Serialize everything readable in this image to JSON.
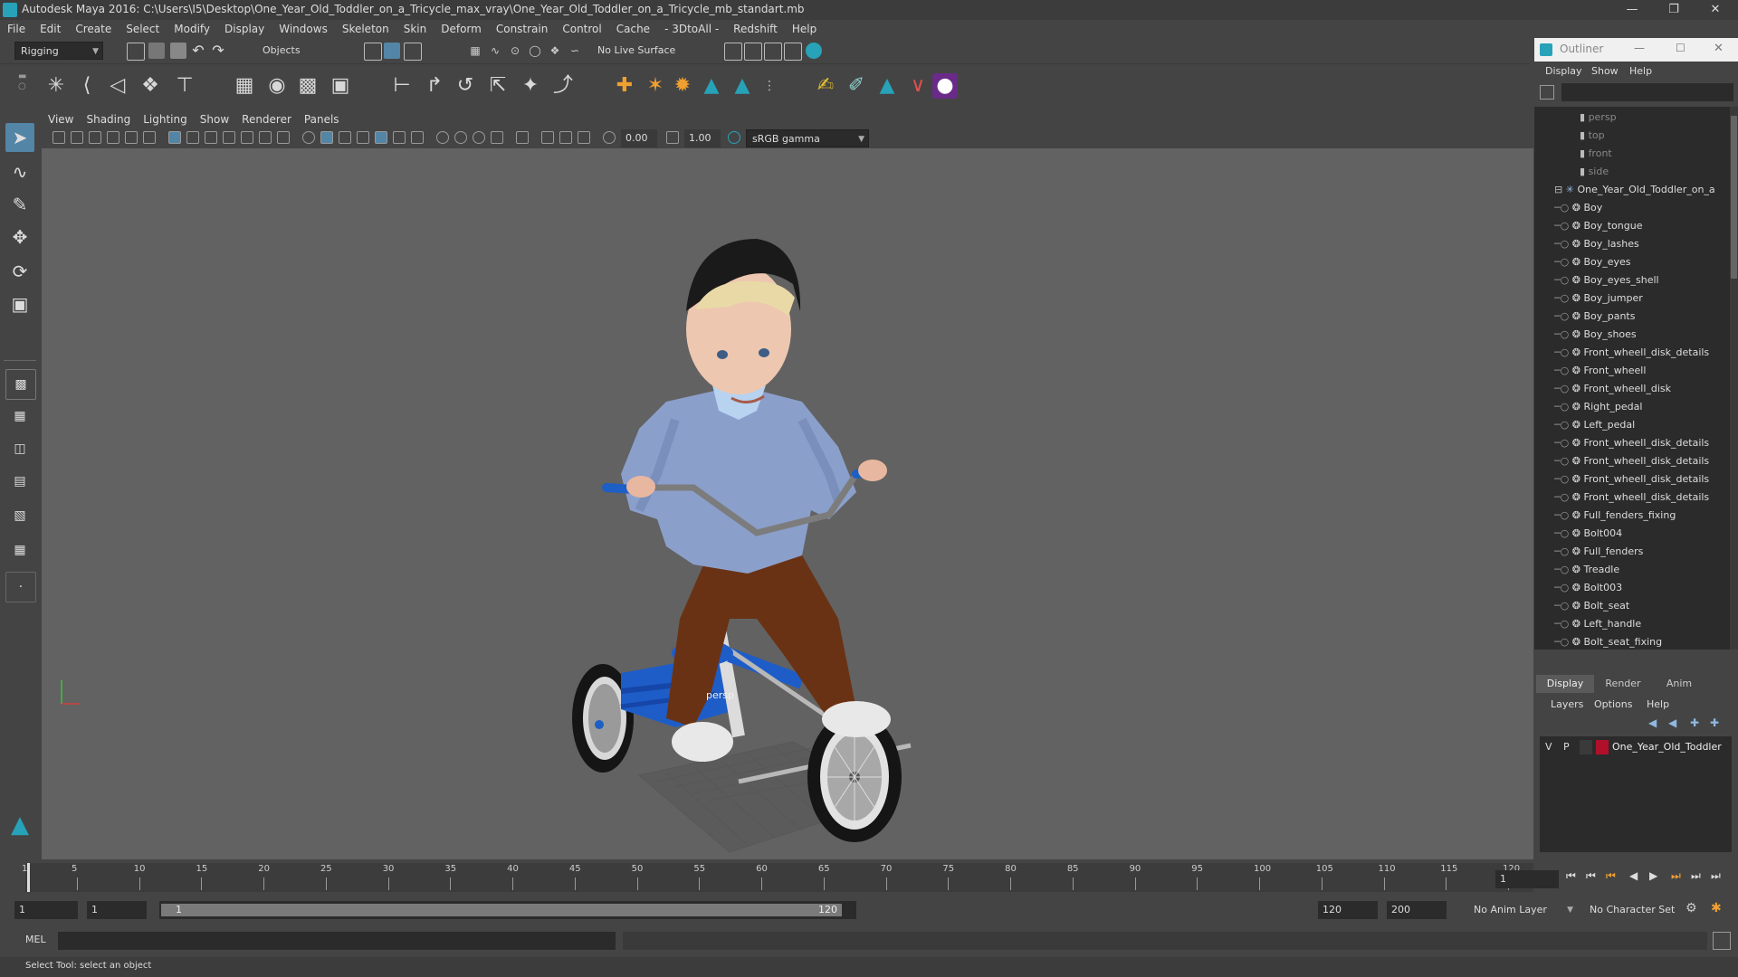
{
  "window": {
    "title": "Autodesk Maya 2016: C:\\Users\\I5\\Desktop\\One_Year_Old_Toddler_on_a_Tricycle_max_vray\\One_Year_Old_Toddler_on_a_Tricycle_mb_standart.mb"
  },
  "menubar": [
    "File",
    "Edit",
    "Create",
    "Select",
    "Modify",
    "Display",
    "Windows",
    "Skeleton",
    "Skin",
    "Deform",
    "Constrain",
    "Control",
    "Cache",
    "- 3DtoAll -",
    "Redshift",
    "Help"
  ],
  "statusline": {
    "menuset": "Rigging",
    "selection_mode": "Objects",
    "live_surface": "No Live Surface"
  },
  "viewport": {
    "menus": [
      "View",
      "Shading",
      "Lighting",
      "Show",
      "Renderer",
      "Panels"
    ],
    "exposure": "0.00",
    "gamma": "1.00",
    "colorspace": "sRGB gamma",
    "camera_label": "persp"
  },
  "outliner": {
    "title": "Outliner",
    "menus": [
      "Display",
      "Show",
      "Help"
    ],
    "cameras": [
      "persp",
      "top",
      "front",
      "side"
    ],
    "group": "One_Year_Old_Toddler_on_a",
    "children": [
      "Boy",
      "Boy_tongue",
      "Boy_lashes",
      "Boy_eyes",
      "Boy_eyes_shell",
      "Boy_jumper",
      "Boy_pants",
      "Boy_shoes",
      "Front_wheell_disk_details",
      "Front_wheell",
      "Front_wheell_disk",
      "Right_pedal",
      "Left_pedal",
      "Front_wheell_disk_details",
      "Front_wheell_disk_details",
      "Front_wheell_disk_details",
      "Front_wheell_disk_details",
      "Full_fenders_fixing",
      "Bolt004",
      "Full_fenders",
      "Treadle",
      "Bolt003",
      "Bolt_seat",
      "Left_handle",
      "Bolt_seat_fixing"
    ]
  },
  "layer_editor": {
    "tabs": [
      "Display",
      "Render",
      "Anim"
    ],
    "menus": [
      "Layers",
      "Options",
      "Help"
    ],
    "layer": {
      "v": "V",
      "p": "P",
      "name": "One_Year_Old_Toddler",
      "color": "#b0102a"
    }
  },
  "timeline": {
    "ticks": [
      "1",
      "5",
      "10",
      "15",
      "20",
      "25",
      "30",
      "35",
      "40",
      "45",
      "50",
      "55",
      "60",
      "65",
      "70",
      "75",
      "80",
      "85",
      "90",
      "95",
      "100",
      "105",
      "110",
      "115",
      "120"
    ],
    "current_frame": "1"
  },
  "range": {
    "start": "1",
    "playback_start": "1",
    "slider_start": "1",
    "slider_end": "120",
    "playback_end": "120",
    "end": "200",
    "anim_layer": "No Anim Layer",
    "char_set": "No Character Set"
  },
  "cmdline": {
    "label": "MEL"
  },
  "helpline": {
    "text": "Select Tool: select an object"
  },
  "colors": {
    "accent": "#5285a6",
    "maya_teal": "#27a2b8"
  }
}
